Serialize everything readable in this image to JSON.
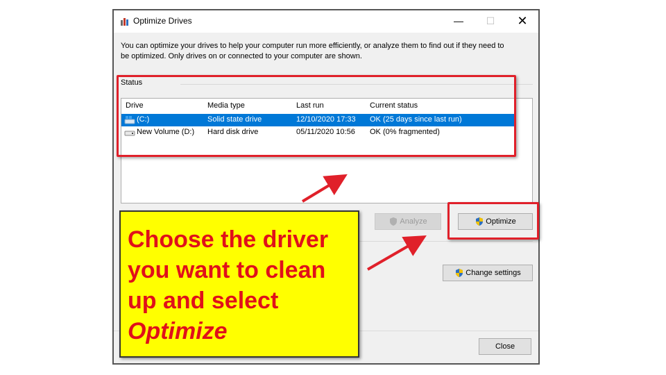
{
  "window": {
    "title": "Optimize Drives",
    "controls": {
      "minimize": "—",
      "maximize": "☐",
      "close": "✕"
    }
  },
  "description": "You can optimize your drives to help your computer run more efficiently, or analyze them to find out if they need to be optimized. Only drives on or connected to your computer are shown.",
  "status": {
    "label": "Status",
    "columns": [
      "Drive",
      "Media type",
      "Last run",
      "Current status"
    ],
    "rows": [
      {
        "drive": "(C:)",
        "media_type": "Solid state drive",
        "last_run": "12/10/2020 17:33",
        "current_status": "OK (25 days since last run)",
        "selected": true
      },
      {
        "drive": "New Volume (D:)",
        "media_type": "Hard disk drive",
        "last_run": "05/11/2020 10:56",
        "current_status": "OK (0% fragmented)",
        "selected": false
      }
    ]
  },
  "buttons": {
    "analyze": "Analyze",
    "optimize": "Optimize",
    "change_settings": "Change settings",
    "close": "Close"
  },
  "callout": {
    "line1": "Choose the driver",
    "line2": "you want to clean",
    "line3": "up and select",
    "emphasis": "Optimize"
  },
  "colors": {
    "annotation_red": "#e0202a",
    "callout_yellow": "#ffff00",
    "selection_blue": "#0078d7"
  }
}
